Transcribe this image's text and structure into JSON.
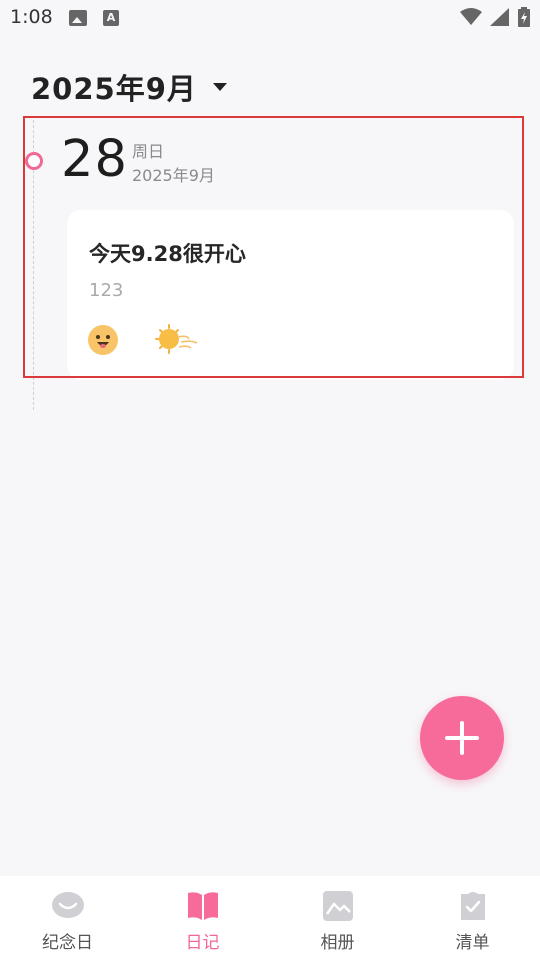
{
  "status_bar": {
    "time": "1:08",
    "icons": [
      "image-icon",
      "a-icon",
      "wifi-icon",
      "signal-icon",
      "battery-icon"
    ]
  },
  "header": {
    "month_title": "2025年9月"
  },
  "entry": {
    "day": "28",
    "weekday": "周日",
    "month": "2025年9月",
    "title": "今天9.28很开心",
    "body": "123",
    "mood": "happy-face-icon",
    "weather": "sunny-windy-icon"
  },
  "fab": {
    "icon": "plus-icon"
  },
  "bottom_nav": {
    "items": [
      {
        "label": "纪念日",
        "icon": "anniversary-icon"
      },
      {
        "label": "日记",
        "icon": "diary-book-icon"
      },
      {
        "label": "相册",
        "icon": "album-icon"
      },
      {
        "label": "清单",
        "icon": "checklist-icon"
      }
    ],
    "active_index": 1
  },
  "colors": {
    "accent": "#f76b9a",
    "background": "#f7f7f9",
    "selection": "#d93a3a"
  }
}
